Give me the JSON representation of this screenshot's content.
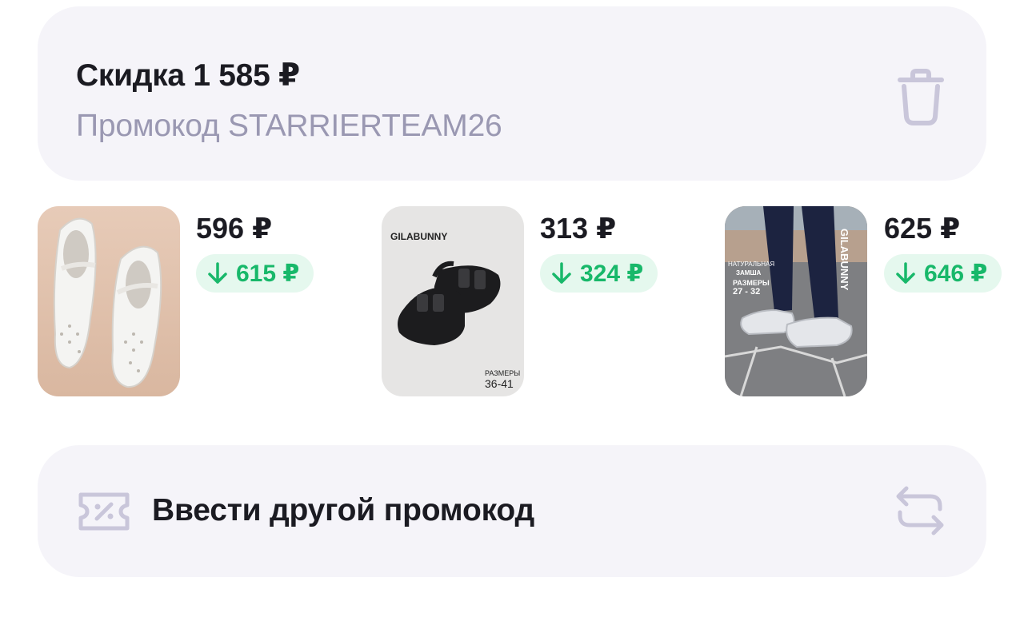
{
  "promo": {
    "title": "Скидка 1 585 ₽",
    "code_text": "Промокод STARRIERTEAM26",
    "delete_icon": "trash-icon"
  },
  "items": [
    {
      "price": "596 ₽",
      "discount": "615 ₽",
      "image": "white-ballet-flats-photo"
    },
    {
      "price": "313 ₽",
      "discount": "324 ₽",
      "image": "black-sandals-photo",
      "brand": "GILABUNNY",
      "sizes_label": "РАЗМЕРЫ",
      "sizes": "36-41"
    },
    {
      "price": "625 ₽",
      "discount": "646 ₽",
      "image": "sneakers-on-feet-photo",
      "brand": "GILABUNNY",
      "badge_top": "НАТУРАЛЬНАЯ",
      "badge_bottom": "ЗАМША",
      "sizes_label": "РАЗМЕРЫ",
      "sizes": "27 - 32"
    }
  ],
  "enter_promo": {
    "label": "Ввести другой промокод",
    "coupon_icon": "coupon-icon",
    "swap_icon": "swap-icon"
  },
  "colors": {
    "card_bg": "#f5f4f9",
    "muted_text": "#9a98b2",
    "discount_green": "#18b86a",
    "discount_bg": "#e5f8ee",
    "icon_gray": "#c9c6da"
  }
}
